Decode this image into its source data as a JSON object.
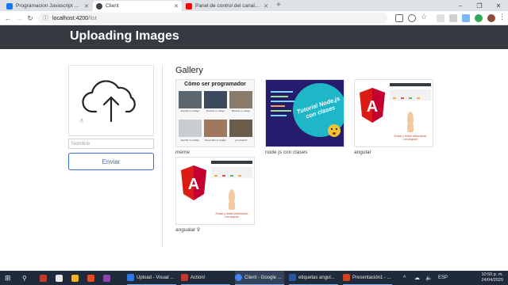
{
  "browser": {
    "tabs": [
      {
        "title": "Programacion Javascript desde 0...",
        "active": false,
        "favicon_color": "#1877f2"
      },
      {
        "title": "Client",
        "active": true,
        "favicon_color": "#444"
      },
      {
        "title": "Panel de control del canal - YouTu...",
        "active": false,
        "favicon_color": "#ff0000"
      }
    ],
    "new_tab": "+",
    "window_controls": {
      "minimize": "–",
      "restore": "❐",
      "close": "✕"
    },
    "url_host": "localhost:4200",
    "url_path": "/list"
  },
  "app": {
    "title": "Uploading Images",
    "name_placeholder": "Nombre",
    "send_label": "Enviar",
    "gallery_title": "Gallery",
    "gallery": [
      {
        "caption": "meme",
        "type": "programador"
      },
      {
        "caption": "node js con clases",
        "type": "node"
      },
      {
        "caption": "angular",
        "type": "angular"
      },
      {
        "caption": "angualar 9",
        "type": "angular"
      }
    ],
    "thumb_texts": {
      "programador_title": "Cómo ser programador",
      "programador_labels": [
        "Escribir tu código",
        "Mostrar tu código",
        "Mostrar tu código",
        "Escribir tu código",
        "Reescribir tu código",
        "¿Funciona?"
      ],
      "node_title": "Tutorial Node.js con clases",
      "angular_caption": "Enviar y recibir información con angular"
    }
  },
  "taskbar": {
    "items": [
      {
        "label": "",
        "color": "#c0392b"
      },
      {
        "label": "",
        "color": "#e8e8e8"
      },
      {
        "label": "",
        "color": "#f0b429"
      },
      {
        "label": "",
        "color": "#e34c26"
      },
      {
        "label": "",
        "color": "#8e44ad"
      },
      {
        "label": "Upload - Visual ...",
        "color": "#2c7be5"
      },
      {
        "label": "Action!",
        "color": "#c0392b"
      },
      {
        "label": "Client - Google ...",
        "color": "#4285f4"
      },
      {
        "label": "etiquetas angul...",
        "color": "#2b579a"
      },
      {
        "label": "Presentación1 - ...",
        "color": "#d04423"
      }
    ],
    "lang": "ESP",
    "time": "10:50 p. m.",
    "date": "24/04/2020"
  }
}
